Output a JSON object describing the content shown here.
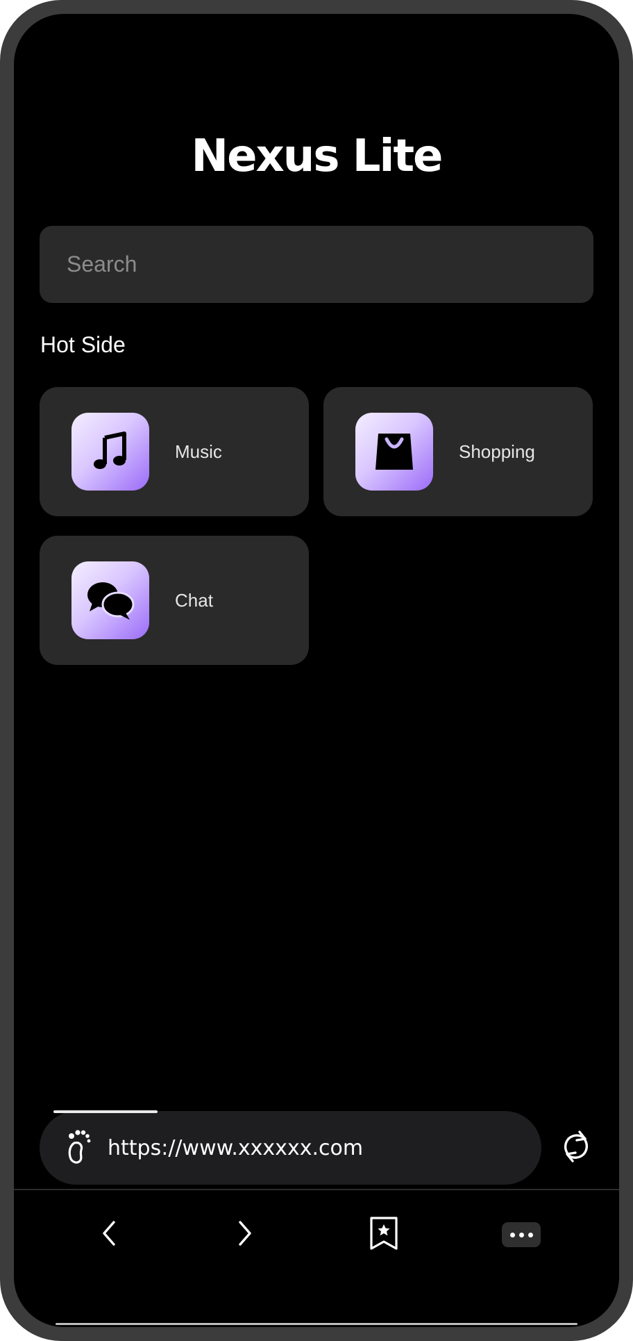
{
  "app": {
    "title": "Nexus Lite"
  },
  "search": {
    "placeholder": "Search",
    "value": ""
  },
  "hot_sites": {
    "heading": "Hot Side",
    "items": [
      {
        "label": "Music",
        "icon": "music-note-icon"
      },
      {
        "label": "Shopping",
        "icon": "shopping-bag-icon"
      },
      {
        "label": "Chat",
        "icon": "chat-bubbles-icon"
      }
    ]
  },
  "browser": {
    "url": "https://www.xxxxxx.com",
    "site_icon": "footprint-icon",
    "load_progress": 0.22,
    "refresh_icon": "refresh-icon"
  },
  "nav": {
    "back_icon": "chevron-left-icon",
    "forward_icon": "chevron-right-icon",
    "bookmark_icon": "bookmark-star-icon",
    "more_icon": "more-dots-icon"
  },
  "colors": {
    "background": "#000000",
    "card": "#2a2a2a",
    "accent_gradient_start": "#f4eeff",
    "accent_gradient_end": "#9b6cf8"
  }
}
